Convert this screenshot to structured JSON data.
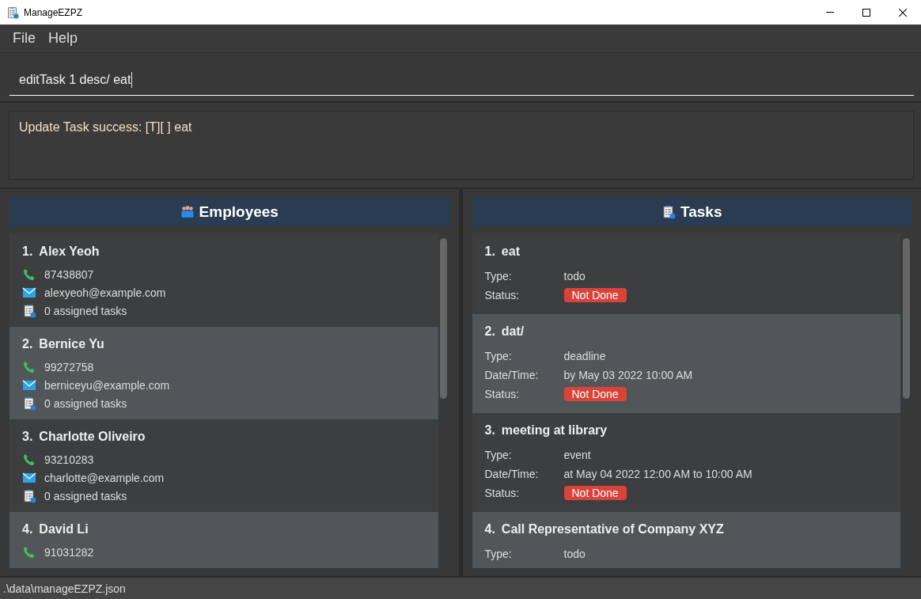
{
  "window": {
    "title": "ManageEZPZ"
  },
  "menu": [
    "File",
    "Help"
  ],
  "command_box": {
    "value": "editTask 1 desc/ eat"
  },
  "result_display": {
    "text": "Update Task success: [T][ ] eat"
  },
  "employees_panel": {
    "title": "Employees",
    "items": [
      {
        "index": "1.",
        "name": "Alex Yeoh",
        "phone": "87438807",
        "email": "alexyeoh@example.com",
        "tasks": "0 assigned tasks"
      },
      {
        "index": "2.",
        "name": "Bernice Yu",
        "phone": "99272758",
        "email": "berniceyu@example.com",
        "tasks": "0 assigned tasks"
      },
      {
        "index": "3.",
        "name": "Charlotte Oliveiro",
        "phone": "93210283",
        "email": "charlotte@example.com",
        "tasks": "0 assigned tasks"
      },
      {
        "index": "4.",
        "name": "David Li",
        "phone": "91031282"
      }
    ]
  },
  "tasks_panel": {
    "title": "Tasks",
    "items": [
      {
        "index": "1.",
        "description": "eat",
        "fields": [
          {
            "kind": "text",
            "label": "Type:",
            "value": "todo"
          },
          {
            "kind": "badge",
            "label": "Status:",
            "value": "Not Done"
          }
        ]
      },
      {
        "index": "2.",
        "description": "dat/",
        "fields": [
          {
            "kind": "text",
            "label": "Type:",
            "value": "deadline"
          },
          {
            "kind": "text",
            "label": "Date/Time:",
            "value": "by May 03 2022 10:00 AM"
          },
          {
            "kind": "badge",
            "label": "Status:",
            "value": "Not Done"
          }
        ]
      },
      {
        "index": "3.",
        "description": "meeting at library",
        "fields": [
          {
            "kind": "text",
            "label": "Type:",
            "value": "event"
          },
          {
            "kind": "text",
            "label": "Date/Time:",
            "value": "at May 04 2022 12:00 AM to 10:00 AM"
          },
          {
            "kind": "badge",
            "label": "Status:",
            "value": "Not Done"
          }
        ]
      },
      {
        "index": "4.",
        "description": "Call Representative of Company XYZ",
        "fields": [
          {
            "kind": "text",
            "label": "Type:",
            "value": "todo"
          }
        ]
      }
    ]
  },
  "status_bar": {
    "path": ".\\data\\manageEZPZ.json"
  }
}
